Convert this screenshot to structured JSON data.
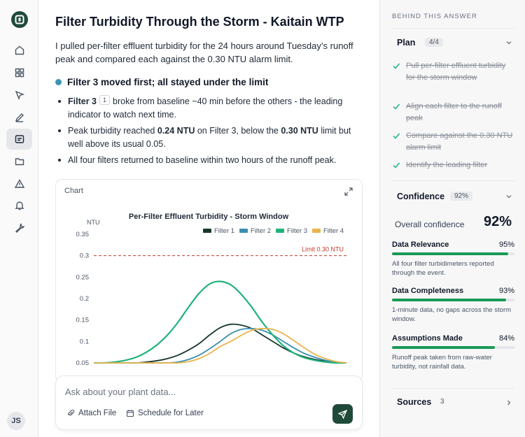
{
  "rail": {
    "icons": [
      "home-icon",
      "dashboard-icon",
      "cursor-icon",
      "pen-icon",
      "chat-icon",
      "folder-icon",
      "alert-icon",
      "bell-icon",
      "wrench-icon"
    ],
    "avatar_initials": "JS"
  },
  "main": {
    "title": "Filter Turbidity Through the Storm - Kaitain WTP",
    "intro": "I pulled per-filter effluent turbidity for the 24 hours around Tuesday’s runoff peak and compared each against the 0.30 NTU alarm limit.",
    "section_heading": "Filter 3 moved first; all stayed under the limit",
    "bullet1": {
      "lead": "Filter 3",
      "cite": "1",
      "rest": "broke from baseline ~40 min before the others - the leading indicator to watch next time."
    },
    "bullet2": {
      "pre": "Peak turbidity reached ",
      "b1": "0.24 NTU",
      "mid": " on Filter 3, below the ",
      "b2": "0.30 NTU",
      "post": " limit but well above its usual 0.05."
    },
    "bullet3": "All four filters returned to baseline within two hours of the runoff peak.",
    "chart_label": "Chart"
  },
  "chart_data": {
    "type": "line",
    "title": "Per-Filter Effluent Turbidity - Storm Window",
    "ylabel": "NTU",
    "ylim": [
      0.05,
      0.35
    ],
    "yticks": [
      "0.35",
      "0.3",
      "0.25",
      "0.2",
      "0.15",
      "0.1",
      "0.05"
    ],
    "limit": {
      "value": 0.3,
      "label": "Limit 0.30 NTU",
      "color": "#c0392b"
    },
    "x": [
      0,
      1,
      2,
      3,
      4,
      5,
      6,
      7,
      8,
      9,
      10,
      11,
      12,
      13,
      14,
      15,
      16,
      17,
      18,
      19,
      20,
      21,
      22,
      23,
      24
    ],
    "series": [
      {
        "name": "Filter 1",
        "color": "#17372c",
        "values": [
          0.05,
          0.05,
          0.05,
          0.05,
          0.05,
          0.052,
          0.055,
          0.06,
          0.068,
          0.08,
          0.095,
          0.115,
          0.132,
          0.14,
          0.138,
          0.13,
          0.115,
          0.1,
          0.085,
          0.073,
          0.064,
          0.058,
          0.054,
          0.051,
          0.05
        ]
      },
      {
        "name": "Filter 2",
        "color": "#3d8fae",
        "values": [
          0.05,
          0.05,
          0.05,
          0.05,
          0.05,
          0.05,
          0.05,
          0.05,
          0.052,
          0.058,
          0.068,
          0.083,
          0.1,
          0.118,
          0.128,
          0.13,
          0.126,
          0.115,
          0.1,
          0.085,
          0.072,
          0.063,
          0.056,
          0.052,
          0.05
        ]
      },
      {
        "name": "Filter 3",
        "color": "#20b27a",
        "values": [
          0.05,
          0.05,
          0.052,
          0.056,
          0.063,
          0.075,
          0.092,
          0.115,
          0.145,
          0.18,
          0.212,
          0.234,
          0.24,
          0.232,
          0.21,
          0.18,
          0.145,
          0.115,
          0.09,
          0.073,
          0.062,
          0.056,
          0.052,
          0.05,
          0.05
        ]
      },
      {
        "name": "Filter 4",
        "color": "#eab54d",
        "values": [
          0.05,
          0.05,
          0.05,
          0.05,
          0.05,
          0.05,
          0.05,
          0.05,
          0.05,
          0.053,
          0.06,
          0.072,
          0.088,
          0.1,
          0.114,
          0.126,
          0.13,
          0.128,
          0.118,
          0.102,
          0.085,
          0.07,
          0.06,
          0.053,
          0.05
        ]
      }
    ],
    "legend": "top-right",
    "grid": false
  },
  "composer": {
    "placeholder": "Ask about your plant data...",
    "attach_label": "Attach File",
    "schedule_label": "Schedule for Later"
  },
  "panel": {
    "header": "BEHIND THIS ANSWER",
    "plan_title": "Plan",
    "plan_count": "4/4",
    "plan_steps": [
      "Pull per-filter effluent turbidity for the storm window",
      "Align each filter to the runoff peak",
      "Compare against the 0.30 NTU alarm limit",
      "Identify the leading filter"
    ],
    "confidence_title": "Confidence",
    "confidence_pill": "92%",
    "overall_label": "Overall confidence",
    "overall_value": "92%",
    "metrics": [
      {
        "label": "Data Relevance",
        "value": "95%",
        "fraction": 0.95,
        "note": "All four filter turbidimeters reported through the event."
      },
      {
        "label": "Data Completeness",
        "value": "93%",
        "fraction": 0.93,
        "note": "1-minute data, no gaps across the storm window."
      },
      {
        "label": "Assumptions Made",
        "value": "84%",
        "fraction": 0.84,
        "note": "Runoff peak taken from raw-water turbidity, not rainfall data."
      }
    ],
    "sources_title": "Sources",
    "sources_count": "3"
  },
  "colors": {
    "accent": "#1f4a3a",
    "progress": "#1a9a55",
    "dot": "#3b94b5"
  }
}
